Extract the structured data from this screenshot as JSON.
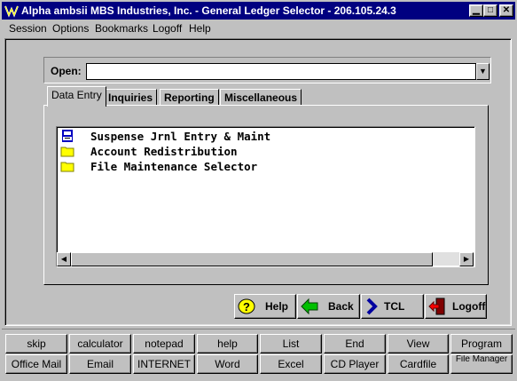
{
  "window": {
    "title": "Alpha ambsii MBS Industries, Inc. - General Ledger Selector - 206.105.24.3",
    "controls": [
      "minimize",
      "maximize",
      "close"
    ]
  },
  "menubar": [
    "Session",
    "Options",
    "Bookmarks",
    "Logoff",
    "Help"
  ],
  "open": {
    "label": "Open:",
    "value": ""
  },
  "tabs": [
    {
      "label": "Data Entry",
      "active": true
    },
    {
      "label": "Inquiries",
      "active": false
    },
    {
      "label": "Reporting",
      "active": false
    },
    {
      "label": "Miscellaneous",
      "active": false
    }
  ],
  "list_items": [
    {
      "label": "Suspense Jrnl Entry & Maint",
      "icon": "printer-icon"
    },
    {
      "label": "Account Redistribution",
      "icon": "folder-icon"
    },
    {
      "label": "File Maintenance Selector",
      "icon": "folder-icon"
    }
  ],
  "nav_buttons": [
    {
      "label": "Help",
      "icon": "help-question-icon"
    },
    {
      "label": "Back",
      "icon": "back-arrow-icon"
    },
    {
      "label": "TCL",
      "icon": "tcl-chevron-icon"
    },
    {
      "label": "Logoff",
      "icon": "logoff-door-icon"
    }
  ],
  "shortcut_row1": [
    "skip",
    "calculator",
    "notepad",
    "help",
    "List",
    "End",
    "View",
    "Program"
  ],
  "shortcut_row2": [
    "Office Mail",
    "Email",
    "INTERNET",
    "Word",
    "Excel",
    "CD Player",
    "Cardfile",
    "File Manager"
  ],
  "colors": {
    "titlebar": "#000080",
    "face": "#c0c0c0",
    "folder": "#ffff00",
    "back_arrow": "#00c000"
  }
}
